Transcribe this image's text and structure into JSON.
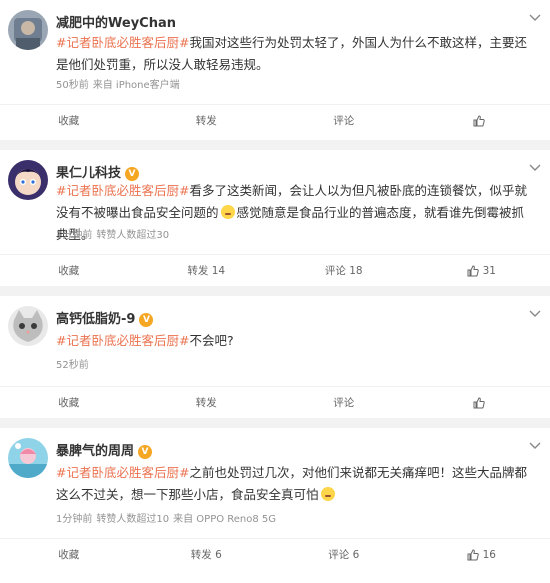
{
  "posts": [
    {
      "author": "减肥中的WeyChan",
      "verified": false,
      "hashtag": "#记者卧底必胜客后厨#",
      "text": "我国对这些行为处罚太轻了，外国人为什么不敢这样，主要还是他们处罚重，所以没人敢轻易违规。",
      "text2": "",
      "time": "50秒前",
      "forward_info": "",
      "source": "来自 iPhone客户端",
      "actions": {
        "fav": "收藏",
        "repost": "转发",
        "comment": "评论",
        "like": ""
      }
    },
    {
      "author": "果仁儿科技",
      "verified": true,
      "hashtag": "#记者卧底必胜客后厨#",
      "text": "看多了这类新闻，会让人以为但凡被卧底的连锁餐饮，似乎就没有不被曝出食品安全问题的",
      "text2": "感觉随意是食品行业的普遍态度，就看谁先倒霉被抓典型。",
      "time": "1分钟前",
      "forward_info": "转赞人数超过30",
      "source": "",
      "actions": {
        "fav": "收藏",
        "repost": "转发 14",
        "comment": "评论 18",
        "like": "31"
      }
    },
    {
      "author": "高钙低脂奶-9",
      "verified": true,
      "hashtag": "#记者卧底必胜客后厨#",
      "text": "不会吧?",
      "text2": "",
      "time": "52秒前",
      "forward_info": "",
      "source": "",
      "actions": {
        "fav": "收藏",
        "repost": "转发",
        "comment": "评论",
        "like": ""
      }
    },
    {
      "author": "暴脾气的周周",
      "verified": true,
      "hashtag": "#记者卧底必胜客后厨#",
      "text": "之前也处罚过几次，对他们来说都无关痛痒吧！这些大品牌都这么不过关，想一下那些小店，食品安全真可怕",
      "text2": "",
      "time": "1分钟前",
      "forward_info": "转赞人数超过10",
      "source": "来自 OPPO Reno8 5G",
      "actions": {
        "fav": "收藏",
        "repost": "转发 6",
        "comment": "评论 6",
        "like": "16"
      }
    }
  ],
  "colors": {
    "hashtag": "#eb7350",
    "verified": "#f5a623",
    "meta": "#939393"
  },
  "icons": {
    "verified": "V",
    "like": "thumbs-up-icon",
    "menu": "chevron-down-icon"
  }
}
